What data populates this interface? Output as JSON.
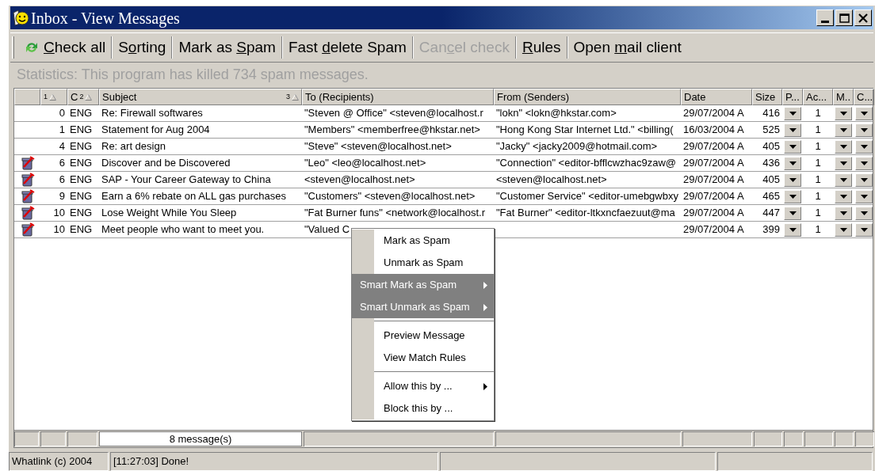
{
  "window": {
    "title": "Inbox - View Messages"
  },
  "toolbar": [
    {
      "key": "C",
      "post": "heck all",
      "disabled": false,
      "icon": true
    },
    {
      "pre": "S",
      "key": "o",
      "post": "rting",
      "disabled": false,
      "icon": false
    },
    {
      "pre": "Mark as ",
      "key": "S",
      "post": "pam",
      "disabled": false,
      "icon": false
    },
    {
      "pre": "Fast ",
      "key": "d",
      "post": "elete Spam",
      "disabled": false,
      "icon": false
    },
    {
      "pre": "Can",
      "key": "c",
      "post": "el check",
      "disabled": true,
      "icon": false
    },
    {
      "key": "R",
      "post": "ules",
      "disabled": false,
      "icon": false
    },
    {
      "pre": "Open ",
      "key": "m",
      "post": "ail client",
      "disabled": false,
      "icon": false
    }
  ],
  "statistics": "Statistics: This program has killed 734 spam messages.",
  "table": {
    "columns": [
      {},
      {
        "sort_rank": "1"
      },
      {
        "label": "C",
        "sort_rank": "2"
      },
      {
        "label": "Subject",
        "sort_rank": "3"
      },
      {
        "label": "To (Recipients)"
      },
      {
        "label": "From (Senders)"
      },
      {
        "label": "Date"
      },
      {
        "label": "Size"
      },
      {
        "label": "P..."
      },
      {
        "label": "Ac..."
      },
      {
        "label": "M.."
      },
      {
        "label": "C..."
      }
    ],
    "rows": [
      {
        "spam": false,
        "score": "0",
        "lang": "ENG",
        "subject": "Re: Firewall softwares",
        "to": "\"Steven @ Office\" <steven@localhost.r",
        "from": "\"lokn\" <lokn@hkstar.com>",
        "date": "29/07/2004 A",
        "size": "416",
        "ac": "1"
      },
      {
        "spam": false,
        "score": "1",
        "lang": "ENG",
        "subject": "Statement for Aug 2004",
        "to": "\"Members\" <memberfree@hkstar.net>",
        "from": "\"Hong Kong Star Internet Ltd.\" <billing(",
        "date": "16/03/2004 A",
        "size": "525",
        "ac": "1"
      },
      {
        "spam": false,
        "score": "4",
        "lang": "ENG",
        "subject": "Re: art design",
        "to": "\"Steve\" <steven@localhost.net>",
        "from": "\"Jacky\" <jacky2009@hotmail.com>",
        "date": "29/07/2004 A",
        "size": "405",
        "ac": "1"
      },
      {
        "spam": true,
        "score": "6",
        "lang": "ENG",
        "subject": "Discover and be Discovered",
        "to": "\"Leo\" <leo@localhost.net>",
        "from": "\"Connection\" <editor-bfflcwzhac9zaw@",
        "date": "29/07/2004 A",
        "size": "436",
        "ac": "1"
      },
      {
        "spam": true,
        "score": "6",
        "lang": "ENG",
        "subject": "SAP - Your Career Gateway to China",
        "to": "<steven@localhost.net>",
        "from": "<steven@localhost.net>",
        "date": "29/07/2004 A",
        "size": "405",
        "ac": "1"
      },
      {
        "spam": true,
        "score": "9",
        "lang": "ENG",
        "subject": "Earn a 6% rebate on ALL gas purchases",
        "to": "\"Customers\" <steven@localhost.net>",
        "from": "\"Customer Service\" <editor-umebgwbxy",
        "date": "29/07/2004 A",
        "size": "465",
        "ac": "1"
      },
      {
        "spam": true,
        "score": "10",
        "lang": "ENG",
        "subject": "Lose Weight While You Sleep",
        "to": "\"Fat Burner funs\" <network@localhost.r",
        "from": "\"Fat Burner\" <editor-ltkxncfaezuut@ma",
        "date": "29/07/2004 A",
        "size": "447",
        "ac": "1"
      },
      {
        "spam": true,
        "score": "10",
        "lang": "ENG",
        "subject": "Meet people who want to meet you.",
        "to": "\"Valued C",
        "date": "29/07/2004 A",
        "size": "399",
        "ac": "1"
      }
    ]
  },
  "context_menu": [
    {
      "kind": "item",
      "label": "Mark as Spam",
      "selected": false,
      "submenu": false
    },
    {
      "kind": "item",
      "label": "Unmark as Spam",
      "selected": false,
      "submenu": false
    },
    {
      "kind": "item",
      "label": "Smart Mark as Spam",
      "selected": true,
      "submenu": true
    },
    {
      "kind": "item",
      "label": "Smart Unmark as Spam",
      "selected": true,
      "submenu": true
    },
    {
      "kind": "separator"
    },
    {
      "kind": "item",
      "label": "Preview Message",
      "selected": false,
      "submenu": false
    },
    {
      "kind": "item",
      "label": "View Match Rules",
      "selected": false,
      "submenu": false
    },
    {
      "kind": "separator"
    },
    {
      "kind": "item",
      "label": "Allow this by ...",
      "selected": false,
      "submenu": true
    },
    {
      "kind": "item",
      "label": "Block this by ...",
      "selected": false,
      "submenu": false
    }
  ],
  "footer": {
    "message_count": "8 message(s)"
  },
  "status_bar": [
    "Whatlink (c) 2004",
    "[11:27:03] Done!"
  ]
}
